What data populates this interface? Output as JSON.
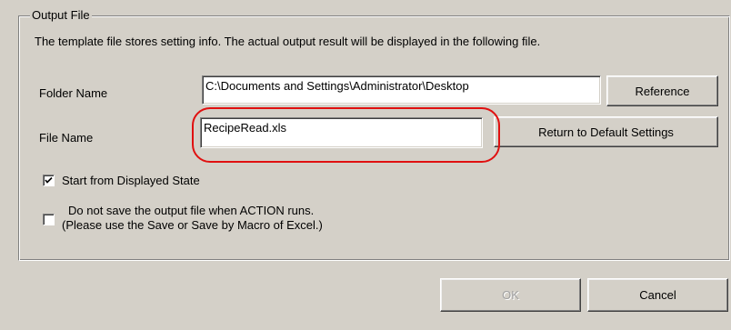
{
  "group": {
    "legend": "Output File"
  },
  "description": "The template file stores setting info. The actual output result will be displayed in the following file.",
  "folder": {
    "label": "Folder Name",
    "value": "C:\\Documents and Settings\\Administrator\\Desktop",
    "button_label": "Reference"
  },
  "file": {
    "label": "File Name",
    "value": "RecipeRead.xls",
    "button_label": "Return to Default Settings"
  },
  "options": {
    "start_from_displayed": {
      "label": "Start from Displayed State",
      "checked": true
    },
    "do_not_save": {
      "label_line1": "Do not save the output file when ACTION runs.",
      "label_line2": "(Please use the Save or Save by Macro of Excel.)",
      "checked": false
    }
  },
  "footer": {
    "ok_label": "OK",
    "ok_enabled": false,
    "cancel_label": "Cancel"
  },
  "colors": {
    "highlight": "#e01010",
    "face": "#d4d0c8"
  }
}
